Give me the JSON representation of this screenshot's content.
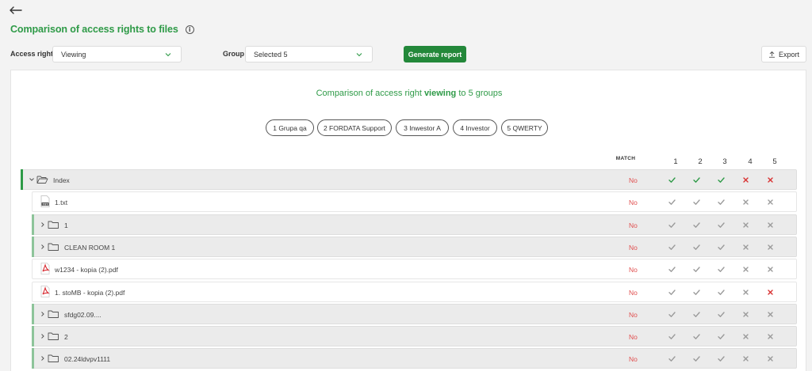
{
  "page": {
    "title": "Comparison of access rights to files",
    "back_icon": "arrow-left-icon",
    "info_icon": "info-icon"
  },
  "filters": {
    "access_right_label": "Access right",
    "access_right_value": "Viewing",
    "group_label": "Group",
    "group_value": "Selected 5",
    "generate_label": "Generate report",
    "export_label": "Export"
  },
  "comparison": {
    "title_prefix": "Comparison of access right",
    "title_right": "viewing",
    "title_suffix": "to 5 groups",
    "groups": [
      "1 Grupa qa",
      "2 FORDATA Support",
      "3 Inwestor A",
      "4 Investor",
      "5 QWERTY"
    ]
  },
  "table": {
    "match_header": "MATCH",
    "columns": [
      "1",
      "2",
      "3",
      "4",
      "5"
    ],
    "rows": [
      {
        "name": "Index",
        "kind": "folder",
        "expanded": true,
        "level": 0,
        "match": "No",
        "marks": [
          "check",
          "check",
          "check",
          "cross",
          "cross"
        ],
        "active": true
      },
      {
        "name": "1.txt",
        "kind": "txt",
        "level": 1,
        "match": "No",
        "marks": [
          "check",
          "check",
          "check",
          "cross",
          "cross"
        ],
        "active": false
      },
      {
        "name": "1",
        "kind": "folder",
        "expanded": false,
        "level": 1,
        "match": "No",
        "marks": [
          "check",
          "check",
          "check",
          "cross",
          "cross"
        ],
        "active": false
      },
      {
        "name": "CLEAN ROOM 1",
        "kind": "folder",
        "expanded": false,
        "level": 1,
        "match": "No",
        "marks": [
          "check",
          "check",
          "check",
          "cross",
          "cross"
        ],
        "active": false
      },
      {
        "name": "w1234 - kopia (2).pdf",
        "kind": "pdf",
        "level": 1,
        "match": "No",
        "marks": [
          "check",
          "check",
          "check",
          "cross",
          "cross"
        ],
        "active": false
      },
      {
        "name": "1. stoMB - kopia (2).pdf",
        "kind": "pdf",
        "level": 1,
        "match": "No",
        "marks": [
          "check",
          "check",
          "check",
          "cross",
          "cross-red"
        ],
        "active": false
      },
      {
        "name": "sfdg02.09....",
        "kind": "folder",
        "expanded": false,
        "level": 1,
        "match": "No",
        "marks": [
          "check",
          "check",
          "check",
          "cross",
          "cross"
        ],
        "active": false
      },
      {
        "name": "2",
        "kind": "folder",
        "expanded": false,
        "level": 1,
        "match": "No",
        "marks": [
          "check",
          "check",
          "check",
          "cross",
          "cross"
        ],
        "active": false
      },
      {
        "name": "02.24ldvpv1111",
        "kind": "folder",
        "expanded": false,
        "level": 1,
        "match": "No",
        "marks": [
          "check",
          "check",
          "check",
          "cross",
          "cross"
        ],
        "active": false
      }
    ]
  },
  "colors": {
    "brand_green": "#2e9a47",
    "button_green": "#23883a",
    "no_red": "#e05050",
    "check_active": "#2e9a47",
    "cross_active": "#d83030",
    "mark_muted": "#9a9a9a"
  }
}
